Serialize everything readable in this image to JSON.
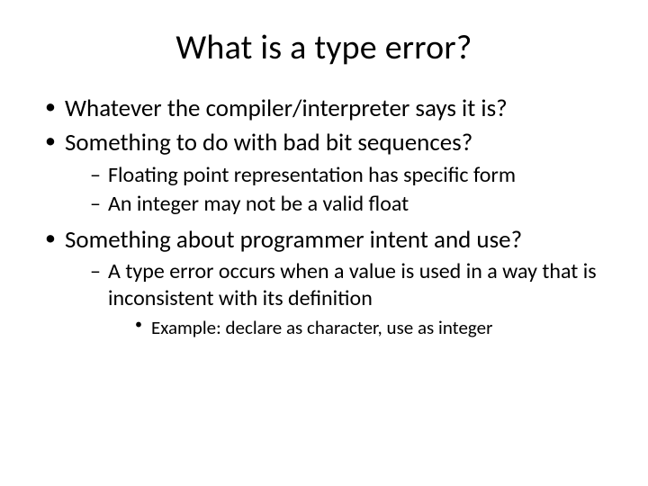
{
  "title": "What is a type error?",
  "bullets": {
    "b1": "Whatever the compiler/interpreter says it is?",
    "b2": "Something to do with bad bit sequences?",
    "b2_1": "Floating point representation has specific form",
    "b2_2": "An integer may not be a valid float",
    "b3": "Something about programmer intent and use?",
    "b3_1": "A type error occurs when a value is used in a way that is inconsistent with its definition",
    "b3_1_1": "Example: declare as character, use as integer"
  }
}
